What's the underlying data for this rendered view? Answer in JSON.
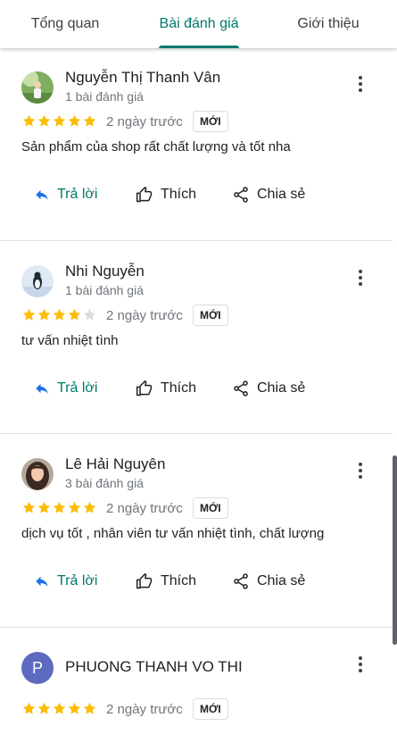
{
  "tabs": [
    {
      "label": "Tổng quan"
    },
    {
      "label": "Bài đánh giá"
    },
    {
      "label": "Giới thiệu"
    }
  ],
  "colors": {
    "accent": "#00796b",
    "star": "#fbbc04",
    "star_empty": "#dadce0",
    "reply_icon": "#1a73e8"
  },
  "actions": {
    "reply": "Trả lời",
    "like": "Thích",
    "share": "Chia sẻ"
  },
  "reviews": [
    {
      "name": "Nguyễn Thị Thanh Vân",
      "count": "1 bài đánh giá",
      "rating": 5,
      "time": "2 ngày trước",
      "badge": "MỚI",
      "text": "Sản phẩm của shop rất chất lượng và tốt nha",
      "avatar": "photo-avatar"
    },
    {
      "name": "Nhi Nguyễn",
      "count": "1 bài đánh giá",
      "rating": 4,
      "time": "2 ngày trước",
      "badge": "MỚI",
      "text": "tư vấn nhiệt tình",
      "avatar": "penguin-avatar"
    },
    {
      "name": "Lê Hải Nguyên",
      "count": "3 bài đánh giá",
      "rating": 5,
      "time": "2 ngày trước",
      "badge": "MỚI",
      "text": "dịch vụ tốt , nhân viên tư vấn nhiệt tình, chất lượng",
      "avatar": "photo-avatar"
    },
    {
      "name": "PHUONG THANH VO THI",
      "avatar_letter": "P",
      "rating": 5,
      "time": "2 ngày trước",
      "badge": "MỚI",
      "avatar": "letter-avatar"
    }
  ]
}
